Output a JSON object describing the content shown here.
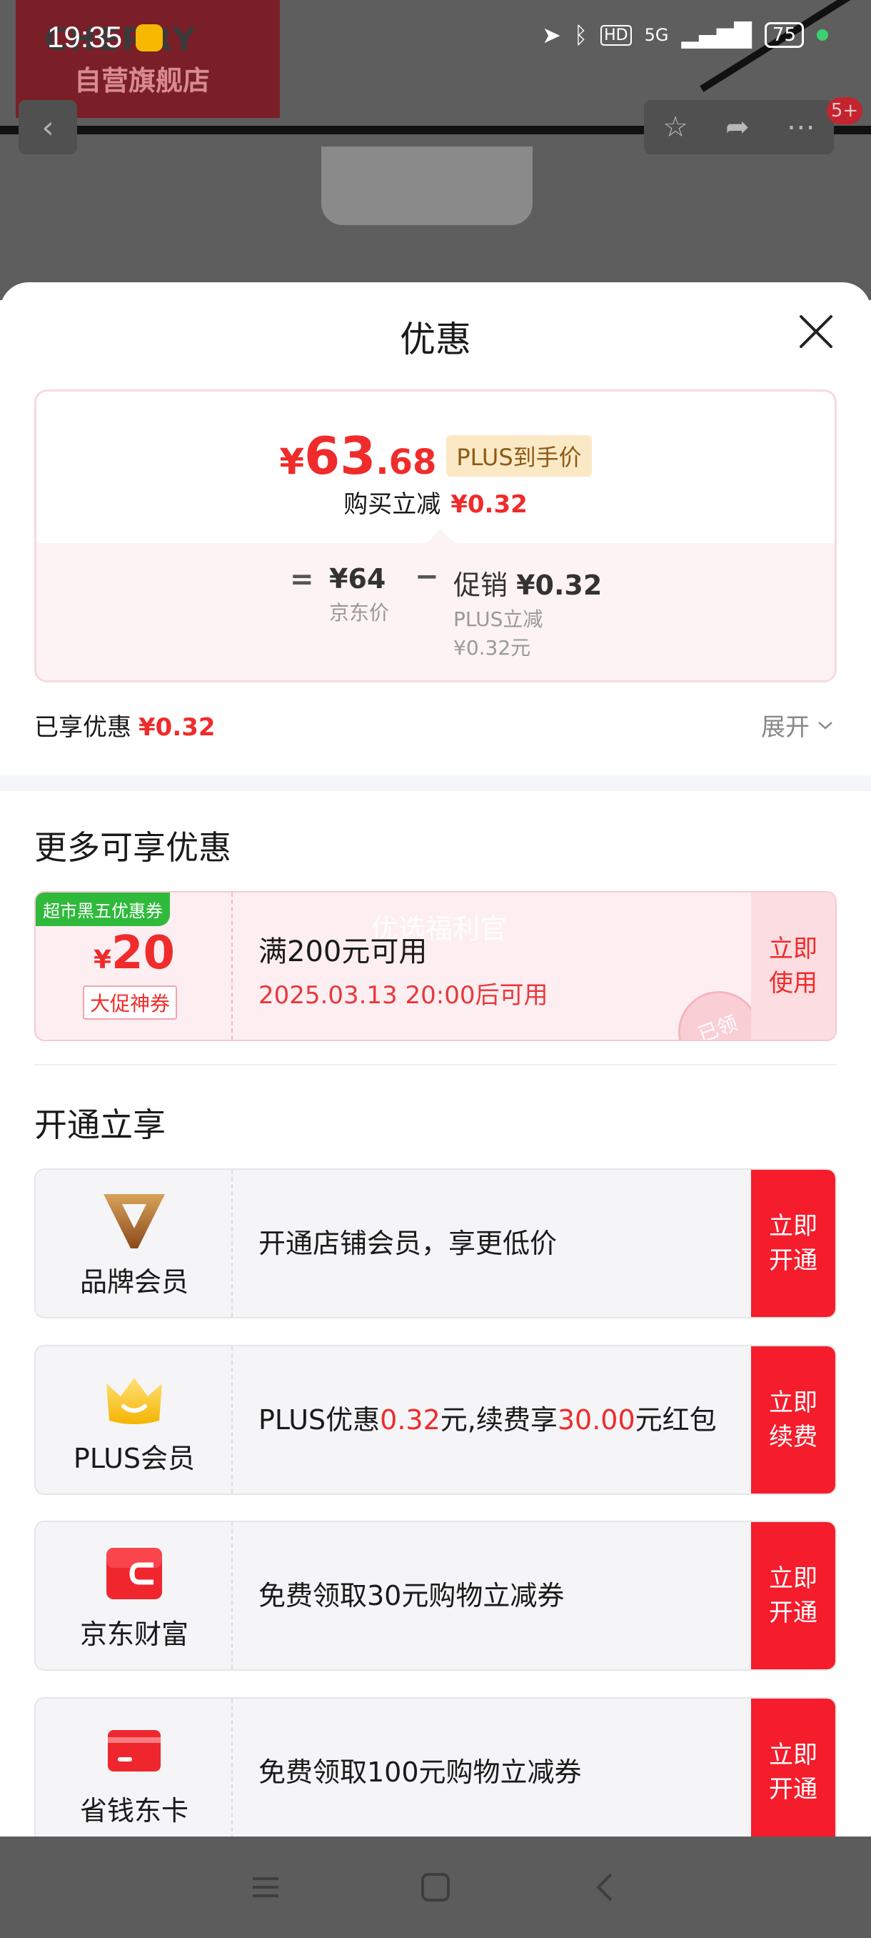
{
  "status_bar": {
    "time": "19:35",
    "network": "5G",
    "battery": "75"
  },
  "background": {
    "logo_line1": "CHERRY",
    "logo_line2": "自营旗舰店",
    "badge": "5+"
  },
  "sheet": {
    "title": "优惠"
  },
  "price_card": {
    "currency": "¥",
    "price_int": "63",
    "price_dec": ".68",
    "plus_tag": "PLUS到手价",
    "reduce_label": "购买立减",
    "reduce_value": "¥0.32",
    "eq": "=",
    "jd_price": "¥64",
    "jd_label": "京东价",
    "minus": "−",
    "promo_label": "促销",
    "promo_value": "¥0.32",
    "promo_sub1": "PLUS立减",
    "promo_sub2": "¥0.32元"
  },
  "enjoyed": {
    "label": "已享优惠",
    "value": "¥0.32",
    "expand": "展开"
  },
  "more_section": {
    "title": "更多可享优惠",
    "coupon": {
      "tag": "超市黑五优惠券",
      "currency": "¥",
      "amount": "20",
      "subtag": "大促神券",
      "condition": "满200元可用",
      "time": "2025.03.13 20:00后可用",
      "button": "立即\n使用",
      "stamp": "已领",
      "watermark": "优选福利官"
    }
  },
  "open_section": {
    "title": "开通立享",
    "cards": [
      {
        "icon": "brand-v-icon",
        "name": "品牌会员",
        "desc_parts": [
          "开通店铺会员，享更低价"
        ],
        "button": "立即\n开通"
      },
      {
        "icon": "crown-icon",
        "name": "PLUS会员",
        "desc_parts": [
          "PLUS优惠",
          "0.32",
          "元,续费享",
          "30.00",
          "元红包"
        ],
        "button": "立即\n续费"
      },
      {
        "icon": "wallet-icon",
        "name": "京东财富",
        "desc_parts": [
          "免费领取30元购物立减券"
        ],
        "button": "立即\n开通"
      },
      {
        "icon": "card-icon",
        "name": "省钱东卡",
        "desc_parts": [
          "免费领取100元购物立减券"
        ],
        "button": "立即\n开通"
      }
    ]
  },
  "colors": {
    "accent_red": "#f02b2b",
    "button_red": "#f51c2c",
    "coupon_green": "#2fba3c",
    "plus_gold": "#8c5a16"
  }
}
